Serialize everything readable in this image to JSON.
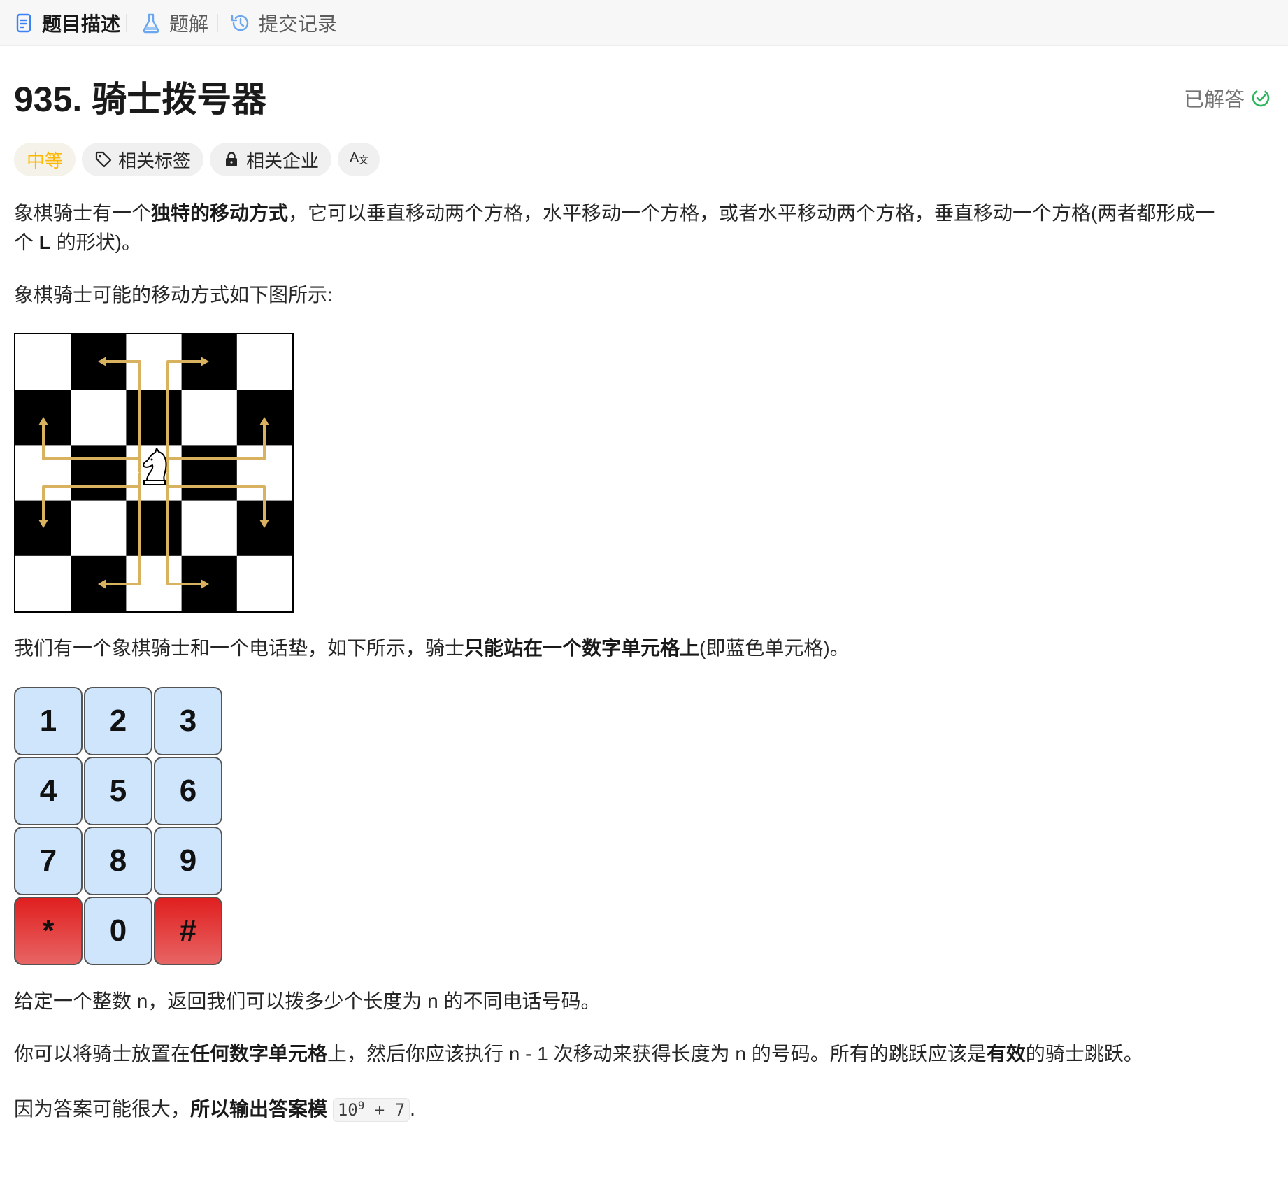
{
  "tabs": [
    {
      "label": "题目描述",
      "icon": "document-icon",
      "active": true
    },
    {
      "label": "题解",
      "icon": "flask-icon",
      "active": false
    },
    {
      "label": "提交记录",
      "icon": "history-icon",
      "active": false
    }
  ],
  "problem": {
    "title": "935. 骑士拨号器",
    "status": "已解答"
  },
  "chips": {
    "difficulty": "中等",
    "tags": "相关标签",
    "companies": "相关企业",
    "translate_icon": "translate-icon"
  },
  "description": {
    "p1": {
      "a": "象棋骑士有一个",
      "b": "独特的移动方式",
      "c": "，它可以垂直移动两个方格，水平移动一个方格，或者水平移动两个方格，垂直移动一个方格(两者都形成一",
      "d": "个 ",
      "e": "L",
      "f": " 的形状)。"
    },
    "p2": "象棋骑士可能的移动方式如下图所示:",
    "p3": {
      "a": "我们有一个象棋骑士和一个电话垫，如下所示，骑士",
      "b": "只能站在一个数字单元格上",
      "c": "(即蓝色单元格)。"
    },
    "p4": "给定一个整数 n，返回我们可以拨多少个长度为 n 的不同电话号码。",
    "p5": {
      "a": "你可以将骑士放置在",
      "b": "任何数字单元格",
      "c": "上，然后你应该执行 n - 1 次移动来获得长度为 n 的号码。所有的跳跃应该是",
      "d": "有效",
      "e": "的骑士跳跃。"
    },
    "p6": {
      "a": "因为答案可能很大，",
      "b": "所以输出答案模",
      "code_base": "10",
      "code_exp": "9",
      "code_rest": " + 7",
      "end": "."
    }
  },
  "keypad": {
    "keys": [
      "1",
      "2",
      "3",
      "4",
      "5",
      "6",
      "7",
      "8",
      "9",
      "*",
      "0",
      "#"
    ],
    "colors": {
      "digit": "#cfe5fb",
      "invalid": "#e01f1f"
    }
  },
  "colors": {
    "arrow": "#d9b25f",
    "accent_medium": "#ffb800",
    "solved_check": "#2db55d",
    "tab_icon": "#3b82f6"
  }
}
